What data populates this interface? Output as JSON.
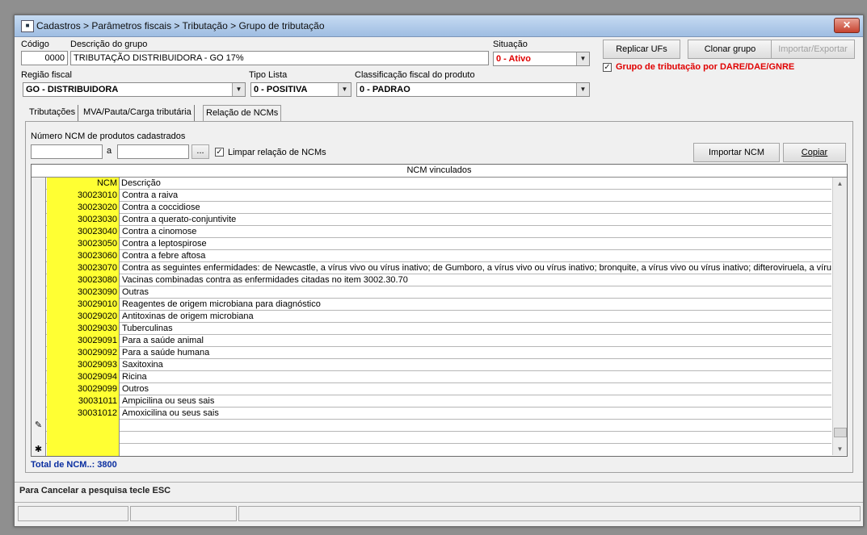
{
  "window": {
    "title": "Cadastros > Parâmetros fiscais > Tributação > Grupo de tributação",
    "close_label": "✕"
  },
  "form": {
    "codigo_label": "Código",
    "codigo_value": "0000",
    "descricao_label": "Descrição do grupo",
    "descricao_value": "TRIBUTAÇÃO DISTRIBUIDORA - GO 17%",
    "situacao_label": "Situação",
    "situacao_value": "0 - Ativo",
    "regiao_label": "Região fiscal",
    "regiao_value": "GO - DISTRIBUIDORA",
    "tipo_lista_label": "Tipo Lista",
    "tipo_lista_value": "0 - POSITIVA",
    "classificacao_label": "Classificação fiscal do produto",
    "classificacao_value": "0 - PADRAO",
    "dare_label": "Grupo de tributação por DARE/DAE/GNRE",
    "dare_checked": "✓"
  },
  "buttons": {
    "replicar": "Replicar UFs",
    "clonar": "Clonar grupo",
    "importar_exportar": "Importar/Exportar",
    "importar_ncm": "Importar NCM",
    "copiar": "Copiar",
    "range_picker": "..."
  },
  "tabs": [
    "Tributações",
    "MVA/Pauta/Carga tributária",
    "Relação de NCMs"
  ],
  "ncm_panel": {
    "range_label": "Número  NCM de produtos cadastrados",
    "range_sep": "a",
    "range_from": "",
    "range_to": "",
    "limpar_label": "Limpar relação de NCMs",
    "limpar_checked": "✓"
  },
  "grid": {
    "caption": "NCM vinculados",
    "header": {
      "ncm": "NCM",
      "desc": "Descrição"
    },
    "rows": [
      {
        "ncm": "30023010",
        "desc": "Contra a raiva"
      },
      {
        "ncm": "30023020",
        "desc": "Contra a coccidiose"
      },
      {
        "ncm": "30023030",
        "desc": "Contra a querato-conjuntivite"
      },
      {
        "ncm": "30023040",
        "desc": "Contra a cinomose"
      },
      {
        "ncm": "30023050",
        "desc": "Contra a leptospirose"
      },
      {
        "ncm": "30023060",
        "desc": "Contra a febre aftosa"
      },
      {
        "ncm": "30023070",
        "desc": "Contra as seguintes enfermidades: de Newcastle, a vírus vivo ou vírus inativo; de Gumboro, a vírus vivo ou vírus inativo; bronquite, a vírus vivo ou vírus inativo; difteroviruela, a vírus vi"
      },
      {
        "ncm": "30023080",
        "desc": "Vacinas combinadas contra as enfermidades citadas no item 3002.30.70"
      },
      {
        "ncm": "30023090",
        "desc": "Outras"
      },
      {
        "ncm": "30029010",
        "desc": "Reagentes de origem microbiana para diagnóstico"
      },
      {
        "ncm": "30029020",
        "desc": "Antitoxinas de origem microbiana"
      },
      {
        "ncm": "30029030",
        "desc": "Tuberculinas"
      },
      {
        "ncm": "30029091",
        "desc": "Para a saúde animal"
      },
      {
        "ncm": "30029092",
        "desc": "Para a saúde humana"
      },
      {
        "ncm": "30029093",
        "desc": "Saxitoxina"
      },
      {
        "ncm": "30029094",
        "desc": "Ricina"
      },
      {
        "ncm": "30029099",
        "desc": "Outros"
      },
      {
        "ncm": "30031011",
        "desc": "Ampicilina ou seus sais"
      },
      {
        "ncm": "30031012",
        "desc": "Amoxicilina ou seus sais"
      }
    ],
    "edit_marker": "✎",
    "new_marker": "✱"
  },
  "footer": {
    "total": "Total de NCM..: 3800",
    "status_message": "Para Cancelar a pesquisa tecle ESC"
  },
  "colors": {
    "ncm_column": "#ffff33",
    "total_text": "#0a2ea0",
    "alert_red": "#e00000"
  }
}
